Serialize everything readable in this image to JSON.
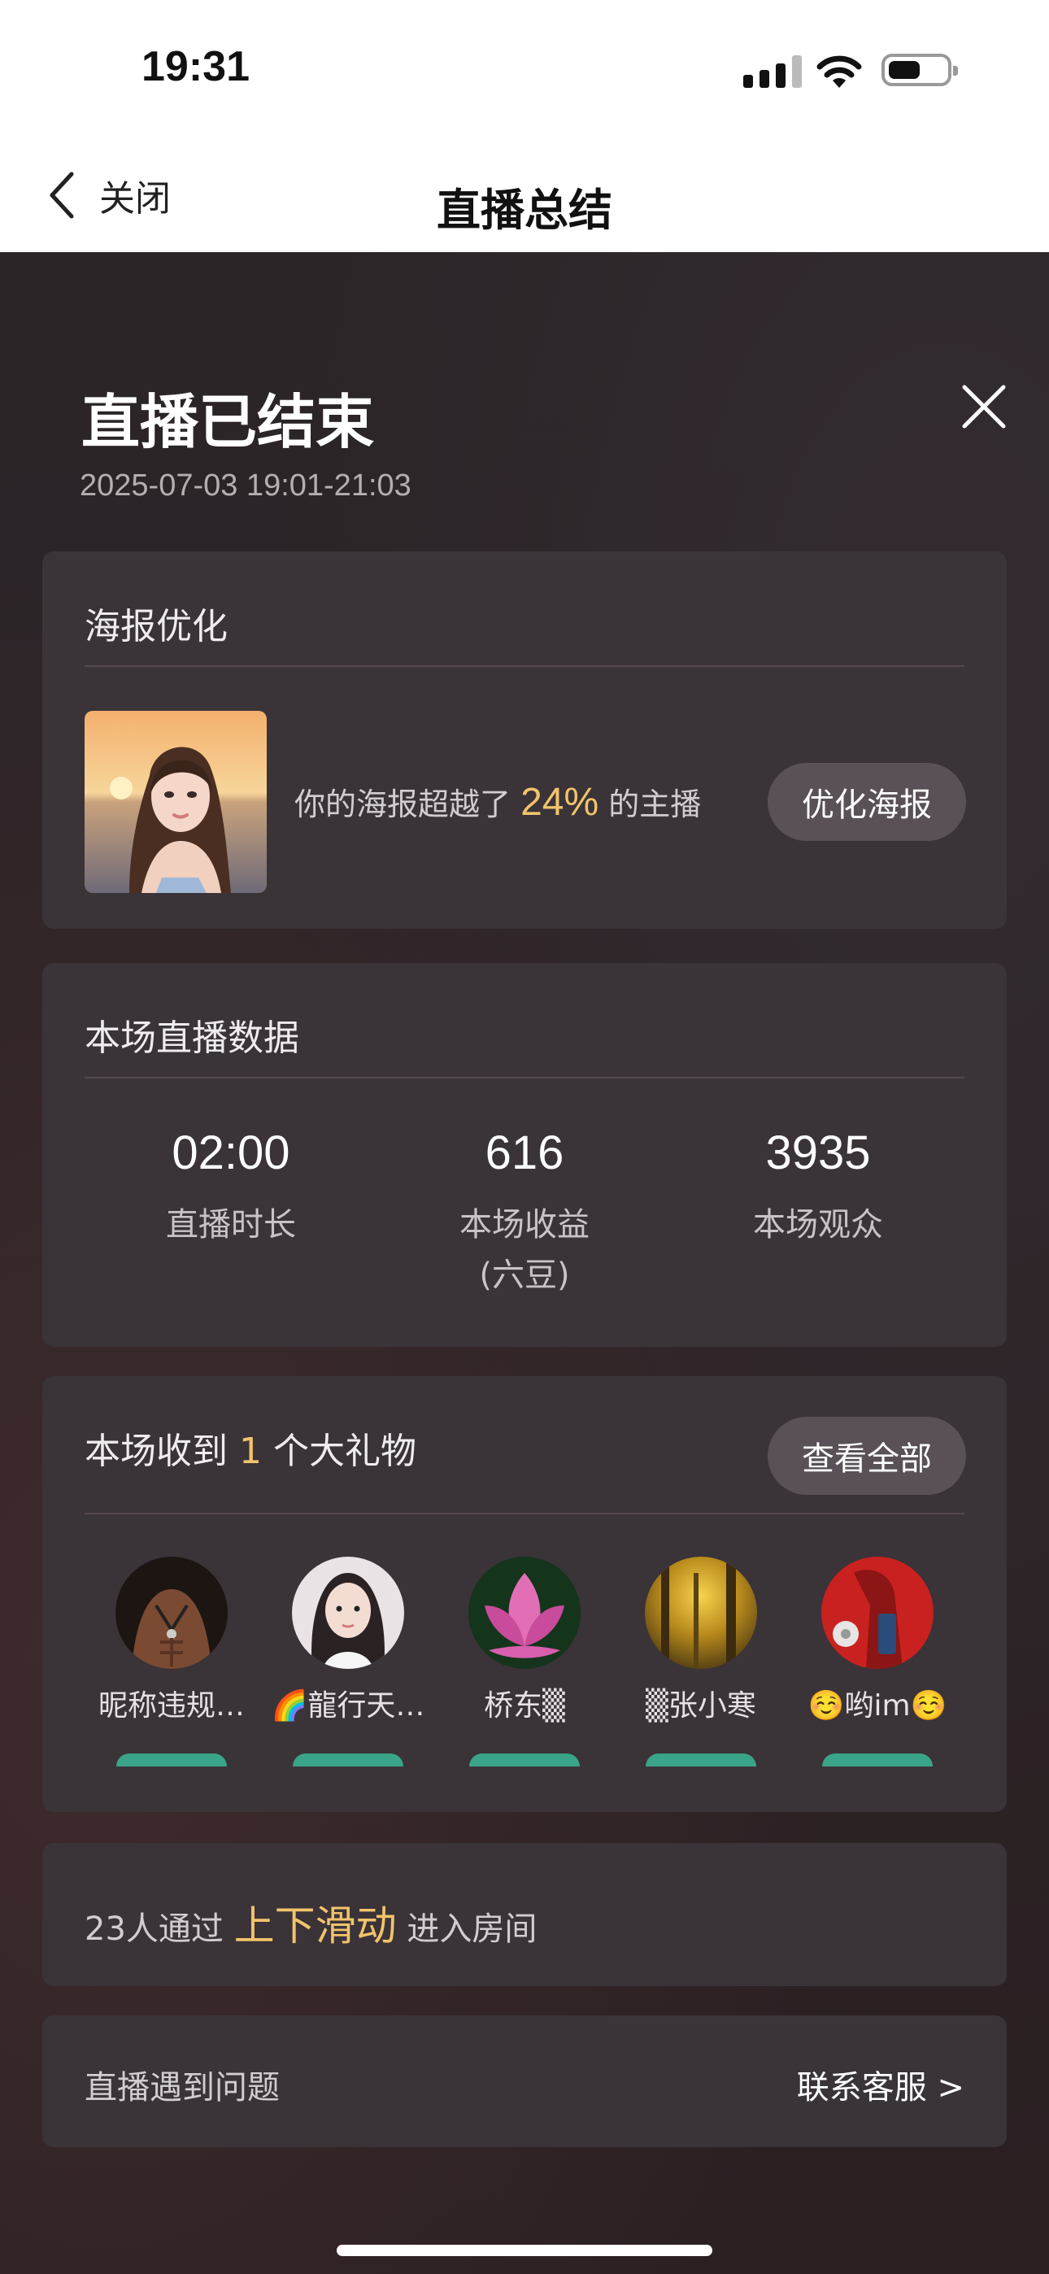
{
  "status_bar": {
    "time": "19:31"
  },
  "nav": {
    "back_label": "关闭",
    "title": "直播总结"
  },
  "header": {
    "title": "直播已结束",
    "time_range": "2025-07-03 19:01-21:03"
  },
  "poster_card": {
    "title": "海报优化",
    "text_before": "你的海报超越了 ",
    "percent": "24%",
    "text_after": " 的主播",
    "button": "优化海报"
  },
  "stats_card": {
    "title": "本场直播数据",
    "items": [
      {
        "value": "02:00",
        "label": "直播时长"
      },
      {
        "value": "616",
        "label": "本场收益\n(六豆)"
      },
      {
        "value": "3935",
        "label": "本场观众"
      }
    ]
  },
  "gifts_card": {
    "title_before": "本场收到 ",
    "count": "1",
    "title_after": " 个大礼物",
    "button": "查看全部",
    "users": [
      {
        "name": "昵称违规…"
      },
      {
        "name": "🌈龍行天…"
      },
      {
        "name": "桥东▒"
      },
      {
        "name": "▒张小寒"
      },
      {
        "name": "☺️哟im☺️"
      }
    ]
  },
  "swipe_card": {
    "text_before": "23人通过 ",
    "highlight": "上下滑动",
    "text_after": " 进入房间"
  },
  "help_card": {
    "label": "直播遇到问题",
    "link": "联系客服 >"
  },
  "colors": {
    "accent": "#f2c36b",
    "card": "#3a3338",
    "pill": "#5a5058"
  }
}
